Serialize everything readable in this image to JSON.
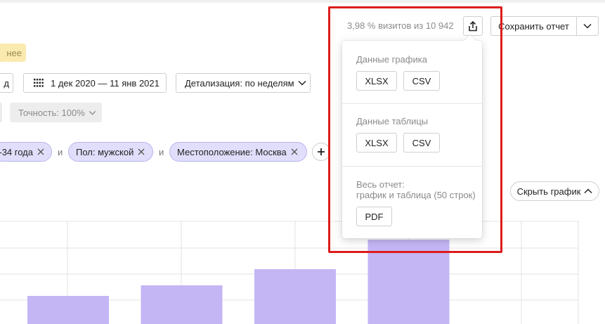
{
  "header": {
    "visits_info": "3,98 % визитов из 10 942",
    "export_icon": "share-upload-icon",
    "save_report_label": "Сохранить отчет",
    "save_report_arrow_icon": "chevron-down-icon"
  },
  "filters": {
    "earlier_badge": "нее",
    "period_cut": "д",
    "date_range": "1 дек 2020 — 11 янв 2021",
    "date_icon": "calendar-icon",
    "detail_label": "Детализация: по неделям",
    "accuracy_label": "Точность: 100%"
  },
  "segments": {
    "chips": [
      {
        "label": "-34 года"
      },
      {
        "label": "Пол: мужской"
      },
      {
        "label": "Местоположение: Москва"
      }
    ],
    "joiner": "и",
    "add_icon": "plus-icon"
  },
  "hide_chart_label": "Скрыть график",
  "export_dropdown": {
    "chart_section_title": "Данные графика",
    "table_section_title": "Данные таблицы",
    "report_section_title_line1": "Весь отчет:",
    "report_section_title_line2": "график и таблица (50 строк)",
    "xlsx_label": "XLSX",
    "csv_label": "CSV",
    "pdf_label": "PDF"
  },
  "colors": {
    "bar": "#c4b5f5",
    "chip_bg": "#e0defa",
    "highlight": "#dd1c1c",
    "badge_bg": "#fbeab0"
  },
  "chart_data": {
    "type": "bar",
    "categories": [
      "",
      "",
      "",
      ""
    ],
    "values": [
      40,
      55,
      78,
      120
    ],
    "ylim": [
      0,
      147
    ],
    "grid": true
  }
}
